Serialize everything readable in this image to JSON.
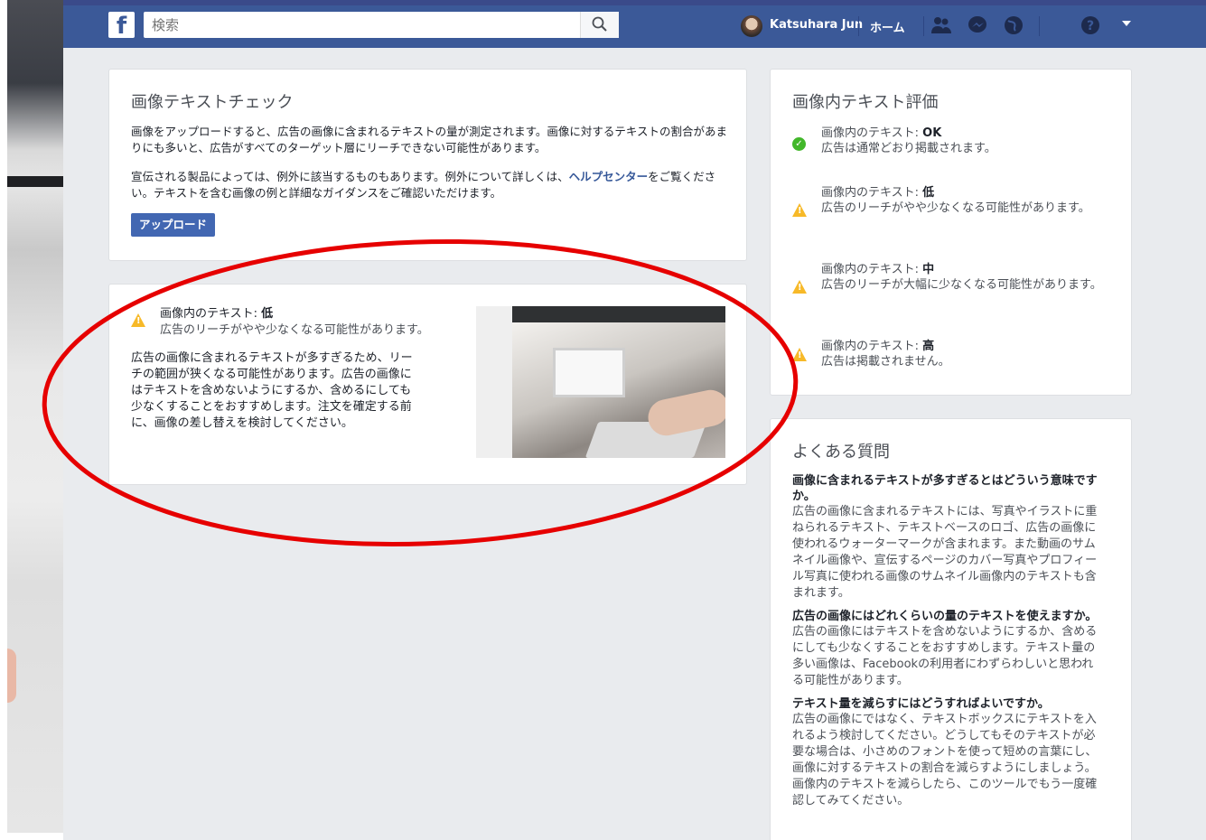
{
  "topbar": {
    "logo": "f",
    "search_placeholder": "検索",
    "user_name": "Katsuhara Jun",
    "home_label": "ホーム",
    "icons": [
      "friends-icon",
      "messenger-icon",
      "globe-icon",
      "help-icon",
      "caret-down-icon"
    ]
  },
  "check_card": {
    "title": "画像テキストチェック",
    "para1": "画像をアップロードすると、広告の画像に含まれるテキストの量が測定されます。画像に対するテキストの割合があまりにも多いと、広告がすべてのターゲット層にリーチできない可能性があります。",
    "para2_before": "宣伝される製品によっては、例外に該当するものもあります。例外について詳しくは、",
    "para2_link": "ヘルプセンター",
    "para2_after": "をご覧ください。テキストを含む画像の例と詳細なガイダンスをご確認いただけます。",
    "upload_label": "アップロード"
  },
  "result_card": {
    "heading_prefix": "画像内のテキスト:",
    "heading_level": "低",
    "subtitle": "広告のリーチがやや少なくなる可能性があります。",
    "body": "広告の画像に含まれるテキストが多すぎるため、リーチの範囲が狭くなる可能性があります。広告の画像にはテキストを含めないようにするか、含めるにしても少なくすることをおすすめします。注文を確定する前に、画像の差し替えを検討してください。"
  },
  "eval_card": {
    "title": "画像内テキスト評価",
    "items": [
      {
        "prefix": "画像内のテキスト:",
        "level": "OK",
        "desc": "広告は通常どおり掲載されます。",
        "icon": "ok-check-icon"
      },
      {
        "prefix": "画像内のテキスト:",
        "level": "低",
        "desc": "広告のリーチがやや少なくなる可能性があります。",
        "icon": "warning-icon"
      },
      {
        "prefix": "画像内のテキスト:",
        "level": "中",
        "desc": "広告のリーチが大幅に少なくなる可能性があります。",
        "icon": "warning-icon"
      },
      {
        "prefix": "画像内のテキスト:",
        "level": "高",
        "desc": "広告は掲載されません。",
        "icon": "warning-icon"
      }
    ]
  },
  "faq_card": {
    "title": "よくある質問",
    "items": [
      {
        "q": "画像に含まれるテキストが多すぎるとはどういう意味ですか。",
        "a": "広告の画像に含まれるテキストには、写真やイラストに重ねられるテキスト、テキストベースのロゴ、広告の画像に使われるウォーターマークが含まれます。また動画のサムネイル画像や、宣伝するページのカバー写真やプロフィール写真に使われる画像のサムネイル画像内のテキストも含まれます。"
      },
      {
        "q": "広告の画像にはどれくらいの量のテキストを使えますか。",
        "a": "広告の画像にはテキストを含めないようにするか、含めるにしても少なくすることをおすすめします。テキスト量の多い画像は、Facebookの利用者にわずらわしいと思われる可能性があります。"
      },
      {
        "q": "テキスト量を減らすにはどうすればよいですか。",
        "a": "広告の画像にではなく、テキストボックスにテキストを入れるよう検討してください。どうしてもそのテキストが必要な場合は、小さめのフォントを使って短めの言葉にし、画像に対するテキストの割合を減らすようにしましょう。画像内のテキストを減らしたら、このツールでもう一度確認してみてください。"
      }
    ]
  },
  "colors": {
    "brand": "#3b5998",
    "button": "#4267b2",
    "warning": "#f7b928",
    "ok": "#42b72a",
    "annotation": "#e60000"
  }
}
